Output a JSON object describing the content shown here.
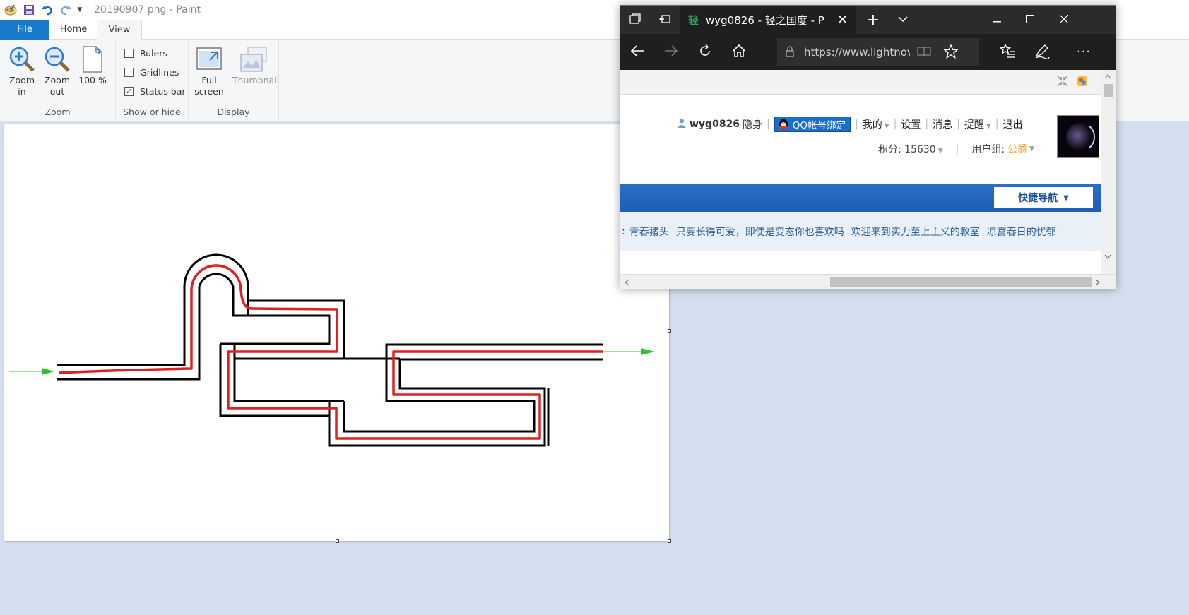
{
  "paint": {
    "title": "20190907.png - Paint",
    "tabs": [
      "File",
      "Home",
      "View"
    ],
    "zoom_group": {
      "label": "Zoom",
      "zoom_in": "Zoom in",
      "zoom_out": "Zoom out",
      "hundred": "100 %"
    },
    "show_hide_group": {
      "label": "Show or hide",
      "rulers": "Rulers",
      "gridlines": "Gridlines",
      "status_bar": "Status bar",
      "rulers_checked": false,
      "gridlines_checked": false,
      "status_bar_checked": true
    },
    "display_group": {
      "label": "Display",
      "full_screen": "Full screen",
      "thumbnail": "Thumbnail"
    }
  },
  "edge": {
    "tab_title": "wyg0826 - 轻之国度 - P",
    "address": "https://www.lightnov"
  },
  "site": {
    "username": "wyg0826",
    "invisible": "隐身",
    "qq_bind": "QQ帐号绑定",
    "nav_links": [
      "我的",
      "设置",
      "消息",
      "提醒",
      "退出"
    ],
    "score_label": "积分: 15630",
    "group_label": "用户组:",
    "group_value": "公爵",
    "quick_nav": "快捷导航",
    "links": [
      "青春猪头",
      "只要长得可爱，即使是变态你也喜欢吗",
      "欢迎来到实力至上主义的教室",
      "凉宫春日的忧郁"
    ],
    "colors": {
      "blue_bar": "#1d5eb5",
      "group_value": "#ff9900",
      "link": "#2f5f9b"
    }
  }
}
